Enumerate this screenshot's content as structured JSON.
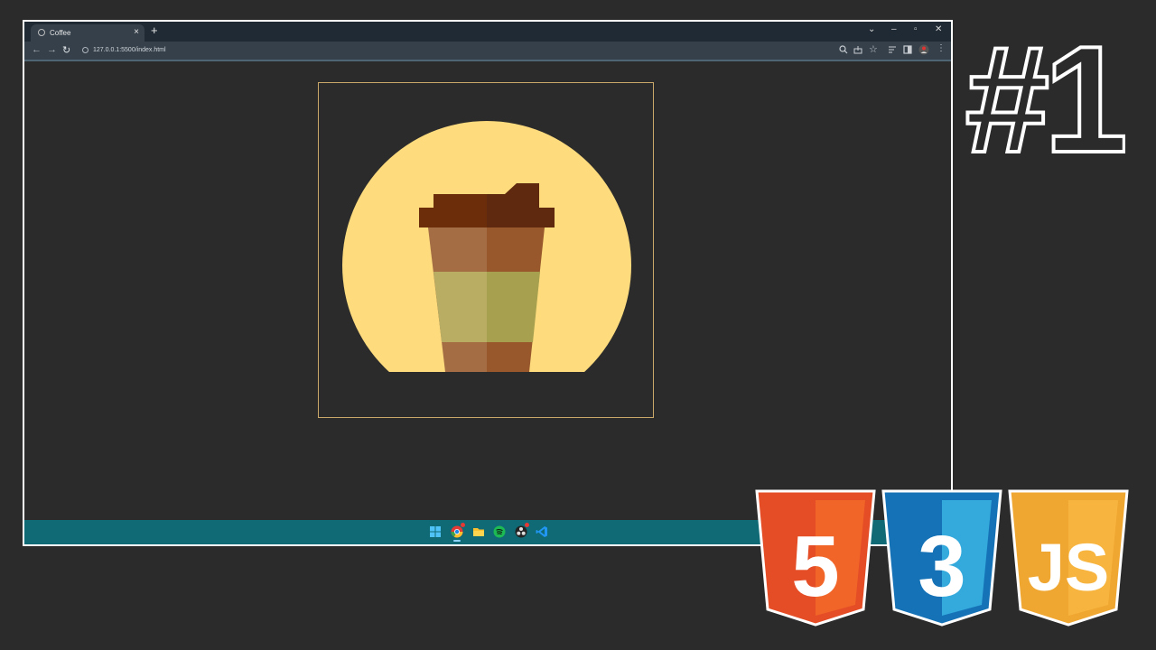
{
  "browser": {
    "tab": {
      "title": "Coffee",
      "favicon": "globe-icon"
    },
    "address": {
      "url": "127.0.0.1:5500/index.html"
    },
    "window_controls": [
      "chevron-down-icon",
      "minimize-icon",
      "restore-icon",
      "close-icon"
    ],
    "toolbar_icons": [
      "zoom-icon",
      "share-icon",
      "star-icon",
      "reading-list-icon",
      "sidebar-icon",
      "profile-icon",
      "more-icon"
    ]
  },
  "illustration": {
    "subject": "coffee-cup",
    "colors": {
      "background": "#2b2b2b",
      "frame": "#c9a86a",
      "sun": "#fedb7d",
      "lid_left": "#6b2d0a",
      "lid_right": "#5e290e",
      "cup_left": "#a56d43",
      "cup_right": "#98582c",
      "sleeve_left": "#b8ad62",
      "sleeve_right": "#a7a04e"
    }
  },
  "taskbar": {
    "apps": [
      "windows-start-icon",
      "chrome-icon",
      "file-explorer-icon",
      "spotify-icon",
      "obs-icon",
      "vscode-icon"
    ]
  },
  "overlay": {
    "episode": "#1",
    "badges": [
      {
        "label": "5",
        "tech": "HTML5",
        "color": "#e44d26",
        "shade": "#f16529"
      },
      {
        "label": "3",
        "tech": "CSS3",
        "color": "#1572b6",
        "shade": "#33a9dc"
      },
      {
        "label": "JS",
        "tech": "JavaScript",
        "color": "#f0a731",
        "shade": "#f7b540"
      }
    ]
  }
}
